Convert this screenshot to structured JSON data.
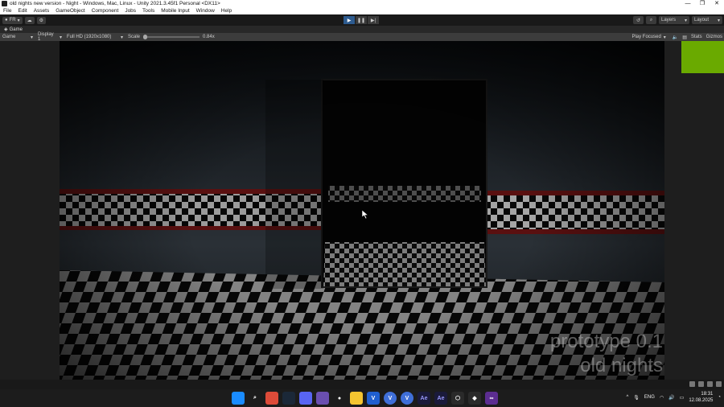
{
  "window": {
    "title": "old nights new version - Night - Windows, Mac, Linux - Unity 2021.3.45f1 Personal <DX11>",
    "minimize": "—",
    "restore": "❐",
    "close": "✕"
  },
  "menu": [
    "File",
    "Edit",
    "Assets",
    "GameObject",
    "Component",
    "Jobs",
    "Tools",
    "Mobile Input",
    "Window",
    "Help"
  ],
  "toolbar": {
    "account_label": "FR",
    "layers_label": "Layers",
    "layout_label": "Layout"
  },
  "tabs": [
    {
      "label": "Game",
      "icon": "gamepad-icon"
    }
  ],
  "game_controls": {
    "view_select": "Game",
    "display_select": "Display 1",
    "resolution_select": "Full HD (1920x1080)",
    "scale_label": "Scale",
    "scale_value": "0.84x",
    "scale_fraction": 0.0,
    "play_mode": "Play Focused",
    "stats_label": "Stats",
    "gizmos_label": "Gizmos"
  },
  "game_overlay": {
    "line1": "prototype 0.1",
    "line2": "old nights"
  },
  "colors": {
    "play_active": "#2d5b8f",
    "swatch": "#6aaa00",
    "stripe_red": "#5a1010"
  },
  "taskbar": {
    "apps": [
      {
        "name": "windows-start-icon",
        "label": "",
        "color": "#1a8cff"
      },
      {
        "name": "search-icon",
        "label": "",
        "color": "#1c1c1c"
      },
      {
        "name": "chrome-icon",
        "label": "",
        "color": "#dd4b39"
      },
      {
        "name": "steam-icon",
        "label": "",
        "color": "#1b2838"
      },
      {
        "name": "discord-icon",
        "label": "",
        "color": "#5865f2"
      },
      {
        "name": "cat-app-icon",
        "label": "",
        "color": "#6a4fb0"
      },
      {
        "name": "dot-app-icon",
        "label": "",
        "color": "#1c1c1c"
      },
      {
        "name": "file-explorer-icon",
        "label": "",
        "color": "#f4c430"
      },
      {
        "name": "vegas-icon",
        "label": "V",
        "color": "#1f5fcf"
      },
      {
        "name": "v-app-icon-1",
        "label": "V",
        "color": "#3f6fd8"
      },
      {
        "name": "v-app-icon-2",
        "label": "V",
        "color": "#3f6fd8"
      },
      {
        "name": "after-effects-icon-1",
        "label": "Ae",
        "color": "#1a1a3a"
      },
      {
        "name": "after-effects-icon-2",
        "label": "Ae",
        "color": "#1a1a3a"
      },
      {
        "name": "unity-hub-icon",
        "label": "",
        "color": "#2a2a2a"
      },
      {
        "name": "unity-icon",
        "label": "",
        "color": "#2a2a2a"
      },
      {
        "name": "visual-studio-icon",
        "label": "",
        "color": "#5c2d91"
      }
    ],
    "language": "ENG",
    "time": "18:31",
    "date": "12.08.2025"
  }
}
